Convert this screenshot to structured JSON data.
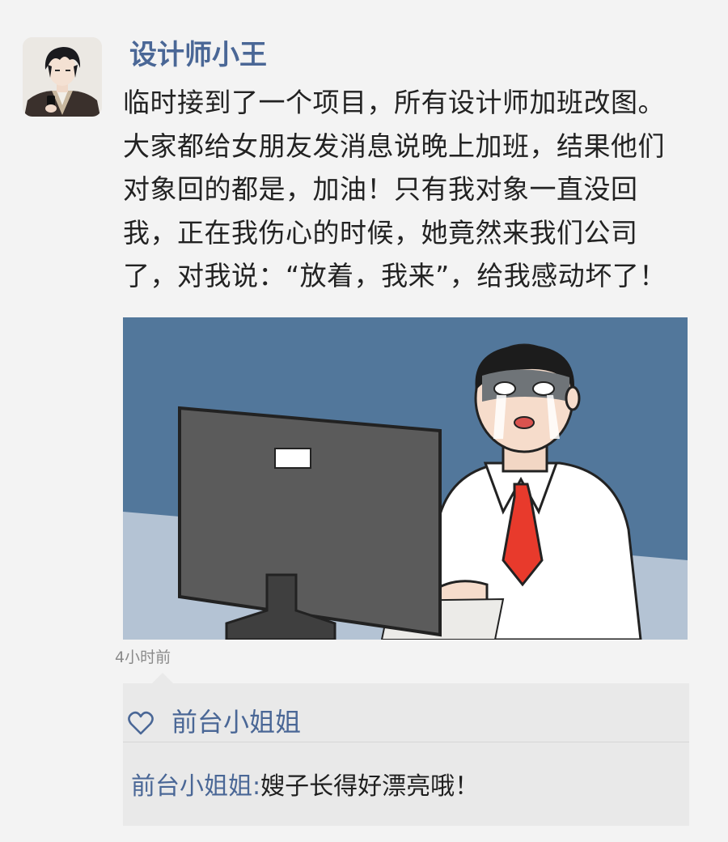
{
  "post": {
    "username": "设计师小王",
    "text": "临时接到了一个项目，所有设计师加班改图。大家都给女朋友发消息说晚上加班，结果他们对象回的都是，加油！只有我对象一直没回我，正在我伤心的时候，她竟然来我们公司了，对我说：“放着，我来”，给我感动坏了！",
    "time": "4小时前"
  },
  "likes": {
    "icon": "heart-icon",
    "names": "前台小姐姐"
  },
  "comment": {
    "author": "前台小姐姐",
    "separator": ":",
    "text": "嫂子长得好漂亮哦！"
  },
  "colors": {
    "background": "#f3f3f3",
    "link": "#4a6796",
    "text": "#222222",
    "comment_bg": "#e9e9e9",
    "muted": "#8a8a8a"
  }
}
